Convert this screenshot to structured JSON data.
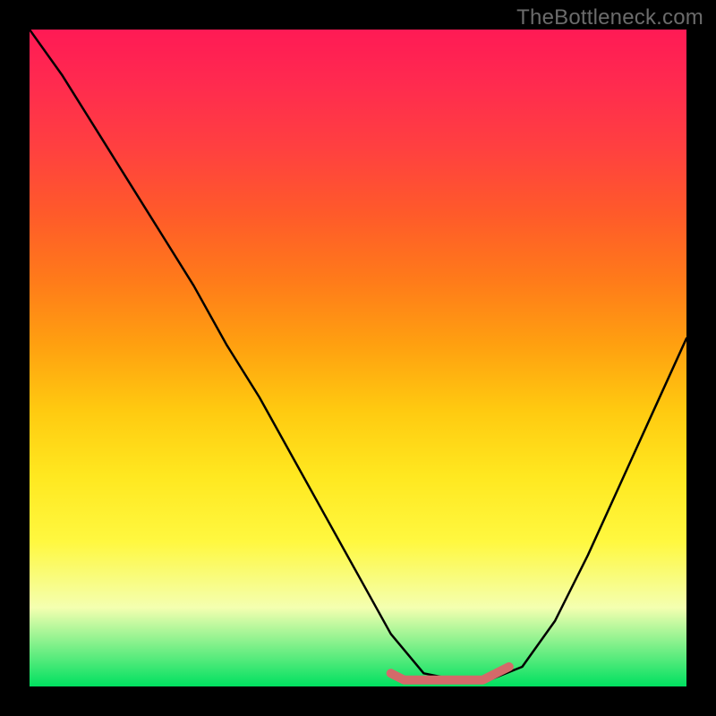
{
  "watermark": "TheBottleneck.com",
  "chart_data": {
    "type": "line",
    "title": "",
    "xlabel": "",
    "ylabel": "",
    "xlim": [
      0,
      100
    ],
    "ylim": [
      0,
      100
    ],
    "legend": false,
    "grid": false,
    "background_gradient": {
      "top": "#ff1a55",
      "middle": "#ffd020",
      "bottom": "#00e060"
    },
    "series": [
      {
        "name": "bottleneck-curve",
        "color": "#000000",
        "x": [
          0,
          5,
          10,
          15,
          20,
          25,
          30,
          35,
          40,
          45,
          50,
          55,
          60,
          65,
          70,
          75,
          80,
          85,
          90,
          95,
          100
        ],
        "values": [
          100,
          93,
          85,
          77,
          69,
          61,
          52,
          44,
          35,
          26,
          17,
          8,
          2,
          1,
          1,
          3,
          10,
          20,
          31,
          42,
          53
        ]
      },
      {
        "name": "highlight-band",
        "color": "#d46a6a",
        "x": [
          55,
          57,
          59,
          61,
          63,
          65,
          67,
          69,
          71,
          73
        ],
        "values": [
          2,
          1,
          1,
          1,
          1,
          1,
          1,
          1,
          2,
          3
        ]
      }
    ]
  }
}
